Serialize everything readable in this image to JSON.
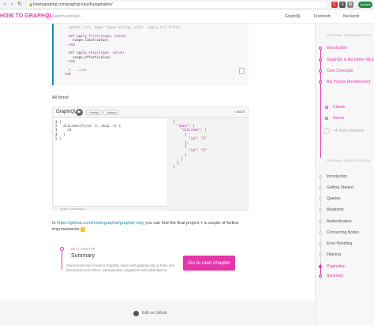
{
  "browser": {
    "url": "howtographql.com/graphql-ruby/8-pagination/",
    "update_label": "Update",
    "extensions": [
      "C",
      "S",
      "M"
    ]
  },
  "header": {
    "logo": "HOW TO GRAPHQL",
    "search_placeholder": "Search tutorials...",
    "nav": [
      "GraphQL",
      "Frontend",
      "Backend"
    ]
  },
  "code_block": {
    "lines": [
      "  option :url, type: types.String, with: :apply_url_filter",
      "",
      "  def apply_first(scope, value)",
      "    scope.limit(value)",
      "  end",
      "",
      "  def apply_skip(scope, value)",
      "    scope.offset(value)",
      "  end",
      "",
      "  # ...code",
      "end"
    ]
  },
  "all_done": "All done!",
  "playground": {
    "title_a": "Graph",
    "title_b": "i",
    "title_c": "QL",
    "run_icon": "play-icon",
    "prettify": "Prettify",
    "history": "History",
    "docs": "Docs",
    "query_lines": [
      "1 {",
      "2   allLinks(first: 2, skip: 1) {",
      "3     id",
      "4   }",
      "5 }"
    ],
    "query_variables": "QUERY VARIABLES",
    "result_lines": [
      "{",
      "  \"data\": {",
      "    \"allLinks\": [",
      "      {",
      "        \"id\": \"2\"",
      "      },",
      "      {",
      "        \"id\": \"3\"",
      "      }",
      "    ]",
      "  }",
      "}"
    ]
  },
  "final": {
    "prefix": "In ",
    "link": "https://github.com/howtographql/graphql-ruby",
    "suffix": " you can find the final project + a couple of further improvements"
  },
  "next_chapter": {
    "label": "NEXT CHAPTER",
    "title": "Summary",
    "description": "You learned how to build a GraphQL server with graphql-ruby & Ruby and best practices for filters, authentication, pagination and subscriptions.",
    "button": "Go to next chapter"
  },
  "footer": {
    "edit": "Edit on Github"
  },
  "sidebar": {
    "fundamentals_head": "GRAPHQL FUNDAMENTALS",
    "fundamentals": [
      {
        "label": "Introduction",
        "state": "done"
      },
      {
        "label": "GraphQL is the better REST",
        "state": "done"
      },
      {
        "label": "Core Concepts",
        "state": "done"
      },
      {
        "label": "Big Picture (Architecture)",
        "state": "done"
      }
    ],
    "sub_items": [
      "Clients",
      "Server"
    ],
    "more": "+4 more chapters",
    "tutorial_head": "GRAPHQL-RUBY TUTORIAL",
    "tutorial": [
      {
        "label": "Introduction",
        "state": "todo"
      },
      {
        "label": "Getting Started",
        "state": "todo"
      },
      {
        "label": "Queries",
        "state": "todo"
      },
      {
        "label": "Mutations",
        "state": "todo"
      },
      {
        "label": "Authentication",
        "state": "todo"
      },
      {
        "label": "Connecting Nodes",
        "state": "todo"
      },
      {
        "label": "Error Handling",
        "state": "todo"
      },
      {
        "label": "Filtering",
        "state": "todo"
      },
      {
        "label": "Pagination",
        "state": "active"
      },
      {
        "label": "Summary",
        "state": "done"
      }
    ]
  },
  "colors": {
    "accent": "#e535ab",
    "code_border": "#1a8bb1",
    "link": "#1a8bb1"
  }
}
